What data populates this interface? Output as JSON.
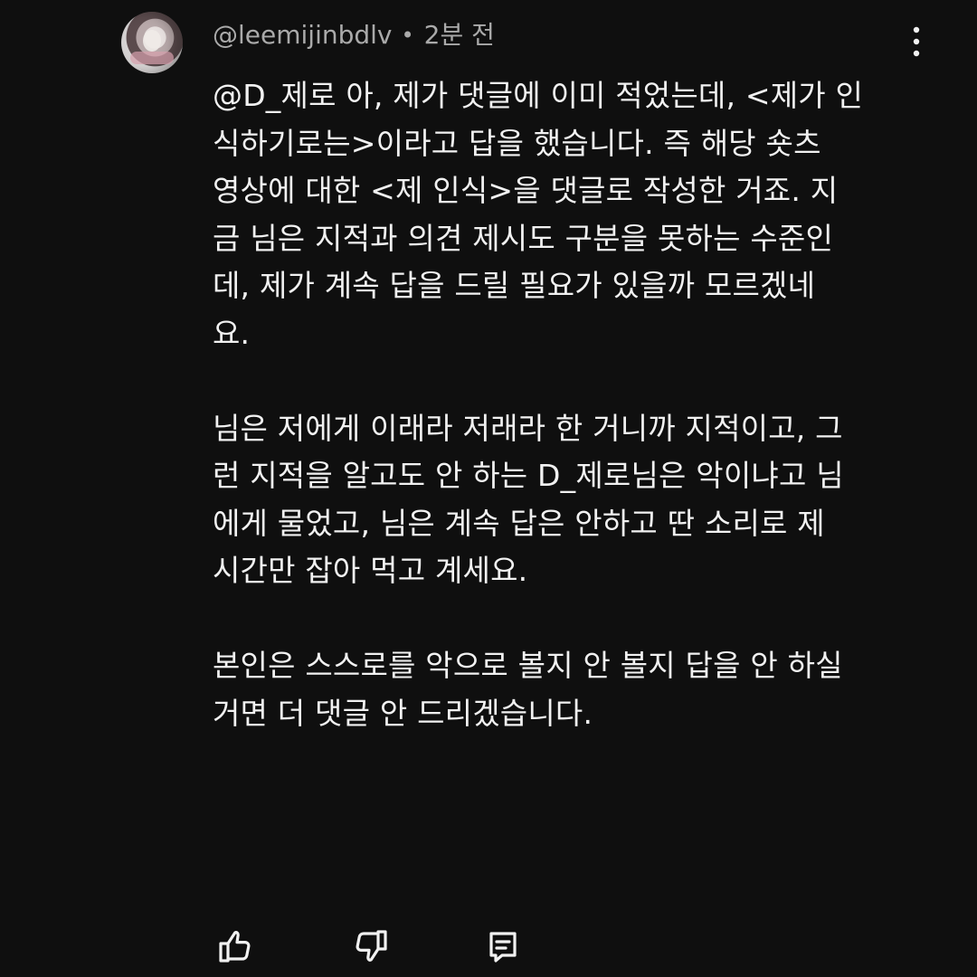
{
  "comment": {
    "username": "@leemijinbdlv",
    "separator": "•",
    "time": "2분 전",
    "body_lines": [
      "@D_제로 아, 제가 댓글에 이미 적었는데, <제가 인",
      "식하기로는>이라고 답을 했습니다. 즉 해당 숏츠",
      "영상에 대한 <제 인식>을 댓글로 작성한 거죠. 지",
      "금 님은 지적과 의견 제시도 구분을 못하는 수준인",
      "데, 제가 계속 답을 드릴 필요가 있을까 모르겠네",
      "요.",
      "",
      "님은 저에게 이래라 저래라 한 거니까 지적이고, 그",
      "런 지적을 알고도 안 하는 D_제로님은 악이냐고 님",
      "에게 물었고, 님은 계속 답은 안하고 딴 소리로 제",
      "시간만 잡아 먹고 계세요.",
      "",
      "본인은 스스로를 악으로 볼지 안 볼지 답을 안 하실",
      "거면 더 댓글 안 드리겠습니다."
    ]
  },
  "icons": {
    "avatar": "profile-avatar",
    "menu": "more-vert-icon",
    "like": "thumb-up-icon",
    "dislike": "thumb-down-icon",
    "reply": "reply-icon"
  },
  "colors": {
    "background": "#0f0f0f",
    "primary_text": "#f1f1f1",
    "secondary_text": "#aaaaaa",
    "icon": "#f1f1f1"
  }
}
